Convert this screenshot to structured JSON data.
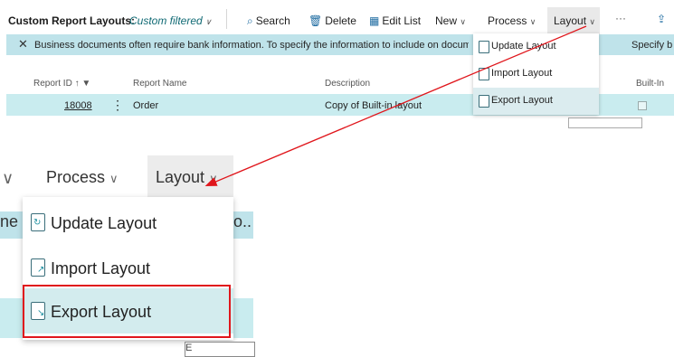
{
  "toolbar": {
    "title": "Custom Report Layouts:",
    "filter": "Custom filtered",
    "search": "Search",
    "delete": "Delete",
    "edit_list": "Edit List",
    "new": "New",
    "process": "Process",
    "layout": "Layout",
    "more": "···"
  },
  "banner": {
    "text": "Business documents often require bank information. To specify the information to include on documer",
    "right_text": "Specify b"
  },
  "table": {
    "columns": [
      "Report ID ↑",
      "Report Name",
      "Description",
      "Built-In"
    ],
    "rows": [
      {
        "report_id": "18008",
        "report_name": "Order",
        "description": "Copy of Built-in layout"
      }
    ]
  },
  "layout_menu": {
    "items": [
      {
        "label": "Update Layout"
      },
      {
        "label": "Import Layout"
      },
      {
        "label": "Export Layout"
      }
    ]
  },
  "zoom": {
    "left_cut": "∨",
    "process": "Process",
    "layout": "Layout",
    "banner_left": "ne",
    "banner_right": "o..",
    "tooltip": "E"
  },
  "colors": {
    "accent": "#106a74",
    "banner": "#bfe3ea",
    "selected_row": "#c9ecef",
    "highlight": "#d3ecee",
    "annotation_red": "#e0161c"
  }
}
